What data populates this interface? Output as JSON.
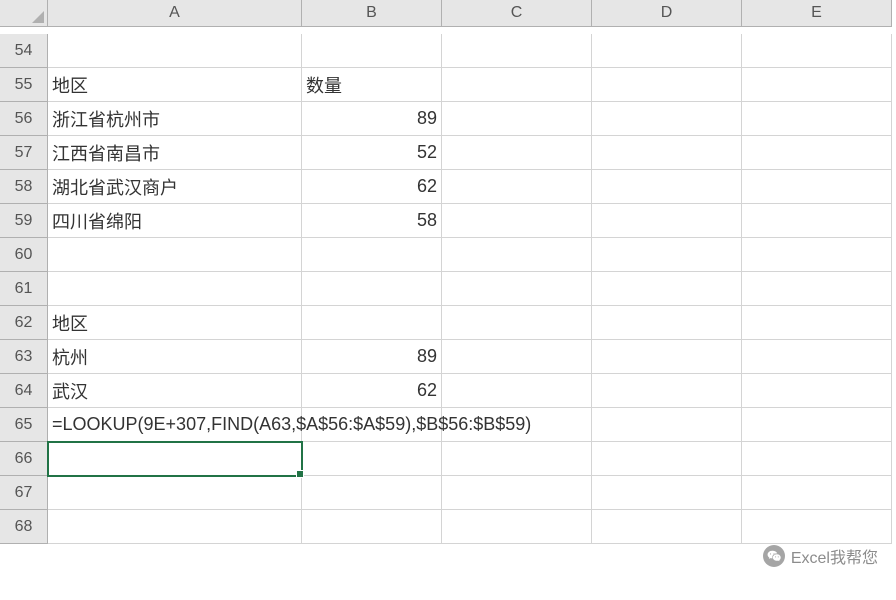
{
  "columns": [
    "A",
    "B",
    "C",
    "D",
    "E"
  ],
  "rows": [
    54,
    55,
    56,
    57,
    58,
    59,
    60,
    61,
    62,
    63,
    64,
    65,
    66,
    67,
    68
  ],
  "selected_cell": "A66",
  "cells": {
    "A55": "地区",
    "B55": "数量",
    "A56": "浙江省杭州市",
    "B56": "89",
    "A57": "江西省南昌市",
    "B57": "52",
    "A58": "湖北省武汉商户",
    "B58": "62",
    "A59": "四川省绵阳",
    "B59": "58",
    "A62": "地区",
    "A63": "杭州",
    "B63": "89",
    "A64": "武汉",
    "B64": "62",
    "A65": "=LOOKUP(9E+307,FIND(A63,$A$56:$A$59),$B$56:$B$59)"
  },
  "overflow_cells": [
    "A65"
  ],
  "number_cells": [
    "B56",
    "B57",
    "B58",
    "B59",
    "B63",
    "B64"
  ],
  "watermark": "Excel我帮您",
  "chart_data": {
    "type": "table",
    "title": "",
    "tables": [
      {
        "columns": [
          "地区",
          "数量"
        ],
        "rows": [
          [
            "浙江省杭州市",
            89
          ],
          [
            "江西省南昌市",
            52
          ],
          [
            "湖北省武汉商户",
            62
          ],
          [
            "四川省绵阳",
            58
          ]
        ]
      },
      {
        "columns": [
          "地区",
          ""
        ],
        "rows": [
          [
            "杭州",
            89
          ],
          [
            "武汉",
            62
          ]
        ]
      }
    ],
    "formula": "=LOOKUP(9E+307,FIND(A63,$A$56:$A$59),$B$56:$B$59)"
  }
}
